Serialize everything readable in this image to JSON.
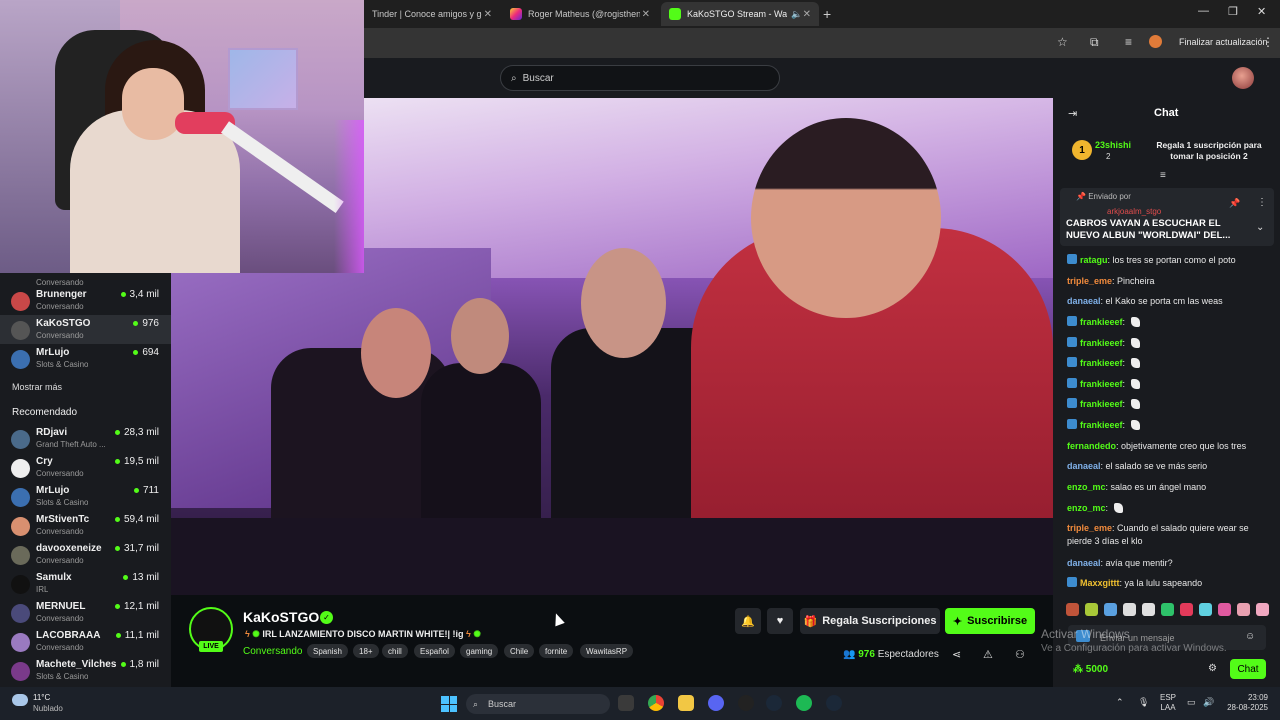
{
  "browser": {
    "tabs": [
      {
        "label": "Tinder | Conoce amigos y gente"
      },
      {
        "label": "Roger Matheus (@rogisthenics)"
      },
      {
        "label": "KaKoSTGO Stream - Watch"
      }
    ],
    "update_button": "Finalizar actualización"
  },
  "header": {
    "search_placeholder": "Buscar"
  },
  "sidebar": {
    "followed": [
      {
        "name": "",
        "category": "Conversando",
        "viewers": ""
      },
      {
        "name": "Brunenger",
        "category": "Conversando",
        "viewers": "3,4 mil",
        "color": "#c94848"
      },
      {
        "name": "KaKoSTGO",
        "category": "Conversando",
        "viewers": "976",
        "color": "#555555"
      },
      {
        "name": "MrLujo",
        "category": "Slots & Casino",
        "viewers": "694",
        "color": "#3b6fb0"
      }
    ],
    "show_more": "Mostrar más",
    "recommended_heading": "Recomendado",
    "recommended": [
      {
        "name": "RDjavi",
        "category": "Grand Theft Auto ...",
        "viewers": "28,3 mil",
        "color": "#4a6a8a"
      },
      {
        "name": "Cry",
        "category": "Conversando",
        "viewers": "19,5 mil",
        "color": "#eeeeee"
      },
      {
        "name": "MrLujo",
        "category": "Slots & Casino",
        "viewers": "711",
        "color": "#3b6fb0"
      },
      {
        "name": "MrStivenTc",
        "category": "Conversando",
        "viewers": "59,4 mil",
        "color": "#d89070"
      },
      {
        "name": "davooxeneize",
        "category": "Conversando",
        "viewers": "31,7 mil",
        "color": "#6a6a5a"
      },
      {
        "name": "Samulx",
        "category": "IRL",
        "viewers": "13 mil",
        "color": "#111111"
      },
      {
        "name": "MERNUEL",
        "category": "Conversando",
        "viewers": "12,1 mil",
        "color": "#4a4a7a"
      },
      {
        "name": "LACOBRAAA",
        "category": "Conversando",
        "viewers": "11,1 mil",
        "color": "#9a7ac0"
      },
      {
        "name": "Machete_Vilches",
        "category": "Slots & Casino",
        "viewers": "1,8 mil",
        "color": "#7a3a8a"
      }
    ]
  },
  "stream": {
    "channel": "KaKoSTGO",
    "live": "LIVE",
    "title": "IRL LANZAMIENTO DISCO MARTIN WHITE!| !ig",
    "category": "Conversando",
    "tags": [
      "Spanish",
      "18+",
      "chill",
      "Español",
      "gaming",
      "Chile",
      "fornite",
      "WawitasRP"
    ],
    "gift_button": "Regala Suscripciones",
    "subscribe_button": "Suscribirse",
    "viewer_count": "976",
    "viewer_label": "Espectadores"
  },
  "chat": {
    "title": "Chat",
    "top_gifter": {
      "rank": "1",
      "name": "23shishi",
      "count": "2"
    },
    "gift_promo": "Regala 1 suscripción para tomar la posición 2",
    "pinned": {
      "from_label": "Enviado por",
      "user": "arkjoaalm_stgo",
      "text": "CABROS VAYAN A ESCUCHAR EL NUEVO ALBUN \"WORLDWAI\" DEL..."
    },
    "messages": [
      {
        "user": "ratagu",
        "color": "#53fc18",
        "text": "los tres se portan como el poto",
        "badge": true
      },
      {
        "user": "triple_eme",
        "color": "#f08a3c",
        "text": "Pincheira",
        "badge": false
      },
      {
        "user": "danaeal",
        "color": "#7fb0e8",
        "text": "el Kako se porta cm las weas",
        "badge": false
      },
      {
        "user": "frankieeef",
        "color": "#53fc18",
        "text": "",
        "badge": true,
        "emote": true
      },
      {
        "user": "frankieeef",
        "color": "#53fc18",
        "text": "",
        "badge": true,
        "emote": true
      },
      {
        "user": "frankieeef",
        "color": "#53fc18",
        "text": "",
        "badge": true,
        "emote": true
      },
      {
        "user": "frankieeef",
        "color": "#53fc18",
        "text": "",
        "badge": true,
        "emote": true
      },
      {
        "user": "frankieeef",
        "color": "#53fc18",
        "text": "",
        "badge": true,
        "emote": true
      },
      {
        "user": "frankieeef",
        "color": "#53fc18",
        "text": "",
        "badge": true,
        "emote": true
      },
      {
        "user": "fernandedo",
        "color": "#53fc18",
        "text": "objetivamente creo que los tres",
        "badge": false
      },
      {
        "user": "danaeal",
        "color": "#7fb0e8",
        "text": "el salado se ve más serio",
        "badge": false
      },
      {
        "user": "enzo_mc",
        "color": "#53fc18",
        "text": "salao es un ángel mano",
        "badge": false
      },
      {
        "user": "enzo_mc",
        "color": "#53fc18",
        "text": "",
        "badge": false,
        "emote": true
      },
      {
        "user": "triple_eme",
        "color": "#f08a3c",
        "text": "Cuando el salado quiere wear se pierde 3 días el klo",
        "badge": false
      },
      {
        "user": "danaeal",
        "color": "#7fb0e8",
        "text": "avía que mentir?",
        "badge": false
      },
      {
        "user": "Maxxgittt",
        "color": "#f0c030",
        "text": "ya la lulu sapeando",
        "badge": true
      }
    ],
    "input_placeholder": "Enviar un mensaje",
    "points": "5000",
    "send_button": "Chat",
    "watermark_title": "Activar Windows",
    "watermark_sub": "Ve a Configuración para activar Windows."
  },
  "taskbar": {
    "temp": "11°C",
    "condition": "Nublado",
    "search": "Buscar",
    "lang_top": "ESP",
    "lang_bottom": "LAA",
    "time": "23:09",
    "date": "28-08-2025"
  }
}
